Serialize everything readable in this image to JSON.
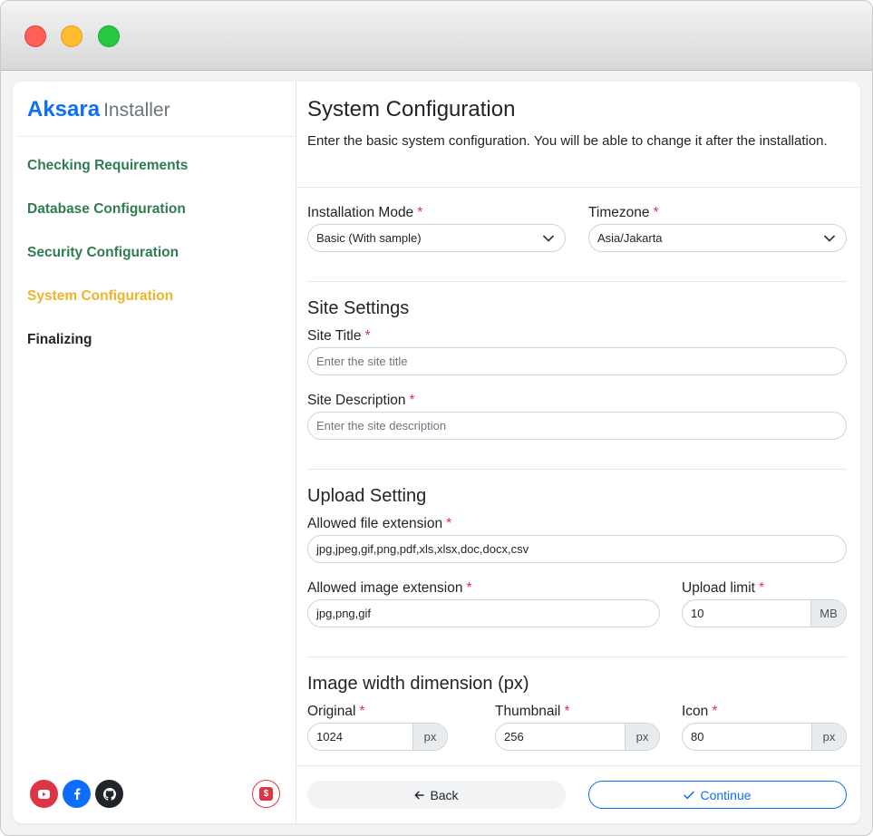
{
  "colors": {
    "accent": "#0d6efd",
    "done": "#2e7d4f",
    "active": "#f0b429",
    "required": "#dc3545"
  },
  "brand": {
    "name": "Aksara",
    "suffix": "Installer"
  },
  "steps": [
    {
      "label": "Checking Requirements",
      "state": "done"
    },
    {
      "label": "Database Configuration",
      "state": "done"
    },
    {
      "label": "Security Configuration",
      "state": "done"
    },
    {
      "label": "System Configuration",
      "state": "active"
    },
    {
      "label": "Finalizing",
      "state": "pending"
    }
  ],
  "socials": [
    "youtube-icon",
    "facebook-icon",
    "github-icon"
  ],
  "page": {
    "title": "System Configuration",
    "description": "Enter the basic system configuration. You will be able to change it after the installation."
  },
  "required_mark": "*",
  "installation_mode": {
    "label": "Installation Mode",
    "value": "Basic (With sample)"
  },
  "timezone": {
    "label": "Timezone",
    "value": "Asia/Jakarta"
  },
  "site_settings": {
    "title": "Site Settings",
    "site_title": {
      "label": "Site Title",
      "placeholder": "Enter the site title",
      "value": ""
    },
    "site_description": {
      "label": "Site Description",
      "placeholder": "Enter the site description",
      "value": ""
    }
  },
  "upload_setting": {
    "title": "Upload Setting",
    "file_ext": {
      "label": "Allowed file extension",
      "value": "jpg,jpeg,gif,png,pdf,xls,xlsx,doc,docx,csv"
    },
    "image_ext": {
      "label": "Allowed image extension",
      "value": "jpg,png,gif"
    },
    "upload_limit": {
      "label": "Upload limit",
      "value": "10",
      "unit": "MB"
    }
  },
  "image_dimension": {
    "title": "Image width dimension (px)",
    "original": {
      "label": "Original",
      "value": "1024",
      "unit": "px"
    },
    "thumbnail": {
      "label": "Thumbnail",
      "value": "256",
      "unit": "px"
    },
    "icon": {
      "label": "Icon",
      "value": "80",
      "unit": "px"
    }
  },
  "buttons": {
    "back": "Back",
    "continue": "Continue"
  }
}
